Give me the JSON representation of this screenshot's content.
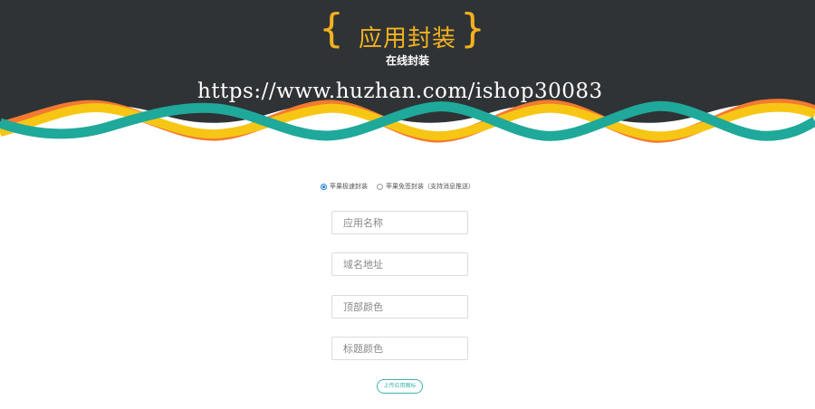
{
  "header": {
    "title": "应用封装",
    "subtitle": "在线封装",
    "brace_left": "{",
    "brace_right": "}",
    "watermark": "https://www.huzhan.com/ishop30083",
    "colors": {
      "background": "#2f3336",
      "accent": "#f5b21e",
      "wave_teal": "#1fa99a",
      "wave_yellow": "#f7c614",
      "wave_orange": "#f47a30"
    }
  },
  "form": {
    "mode_options": [
      {
        "label": "苹果极速封装",
        "selected": true
      },
      {
        "label": "苹果免签封装（支持消息推送）",
        "selected": false
      }
    ],
    "fields": [
      {
        "placeholder": "应用名称",
        "value": ""
      },
      {
        "placeholder": "域名地址",
        "value": ""
      },
      {
        "placeholder": "顶部颜色",
        "value": ""
      },
      {
        "placeholder": "标题颜色",
        "value": ""
      }
    ],
    "upload_button": "上传应用图标"
  }
}
